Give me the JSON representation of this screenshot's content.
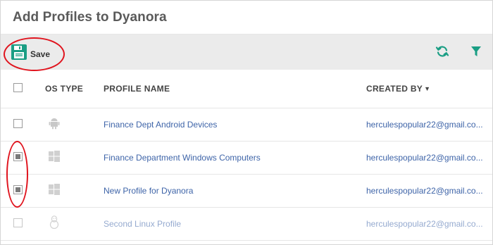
{
  "dialog": {
    "title": "Add Profiles to Dyanora"
  },
  "toolbar": {
    "save_label": "Save",
    "accent_color": "#1a9e84"
  },
  "table": {
    "columns": {
      "os_type": "OS TYPE",
      "profile_name": "PROFILE NAME",
      "created_by": "CREATED BY"
    },
    "sort_indicator": "▼",
    "rows": [
      {
        "os_icon": "android-icon",
        "profile_name": "Finance Dept Android Devices",
        "created_by": "herculespopular22@gmail.co...",
        "checked": false
      },
      {
        "os_icon": "windows-icon",
        "profile_name": "Finance Department Windows Computers",
        "created_by": "herculespopular22@gmail.co...",
        "checked": true
      },
      {
        "os_icon": "windows-icon",
        "profile_name": "New Profile for Dyanora",
        "created_by": "herculespopular22@gmail.co...",
        "checked": true
      },
      {
        "os_icon": "linux-icon",
        "profile_name": "Second Linux Profile",
        "created_by": "herculespopular22@gmail.co...",
        "checked": false
      }
    ]
  }
}
